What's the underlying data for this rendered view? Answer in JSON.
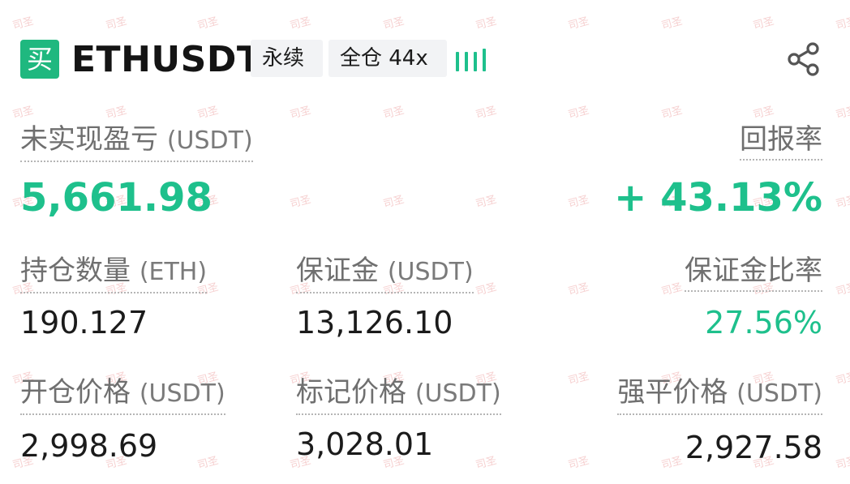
{
  "header": {
    "side_badge": "买",
    "symbol": "ETHUSDT",
    "contract_type": "永续",
    "margin_mode": "全仓 44x",
    "leverage_bars": {
      "filled": 4,
      "total": 4
    },
    "share_icon": "share-icon"
  },
  "pnl": {
    "label": "未实现盈亏",
    "unit": "(USDT)",
    "value": "5,661.98"
  },
  "roe": {
    "label": "回报率",
    "value": "+ 43.13%"
  },
  "position_size": {
    "label": "持仓数量",
    "unit": "(ETH)",
    "value": "190.127"
  },
  "margin": {
    "label": "保证金",
    "unit": "(USDT)",
    "value": "13,126.10"
  },
  "margin_ratio": {
    "label": "保证金比率",
    "value": "27.56%"
  },
  "entry_price": {
    "label": "开仓价格",
    "unit": "(USDT)",
    "value": "2,998.69"
  },
  "mark_price": {
    "label": "标记价格",
    "unit": "(USDT)",
    "value": "3,028.01"
  },
  "liq_price": {
    "label": "强平价格",
    "unit": "(USDT)",
    "value": "2,927.58"
  },
  "watermark": "司圣",
  "colors": {
    "green": "#1ec08c",
    "badge_green": "#1fb87f",
    "text": "#1b1b1b",
    "label": "#6f6f6f"
  }
}
